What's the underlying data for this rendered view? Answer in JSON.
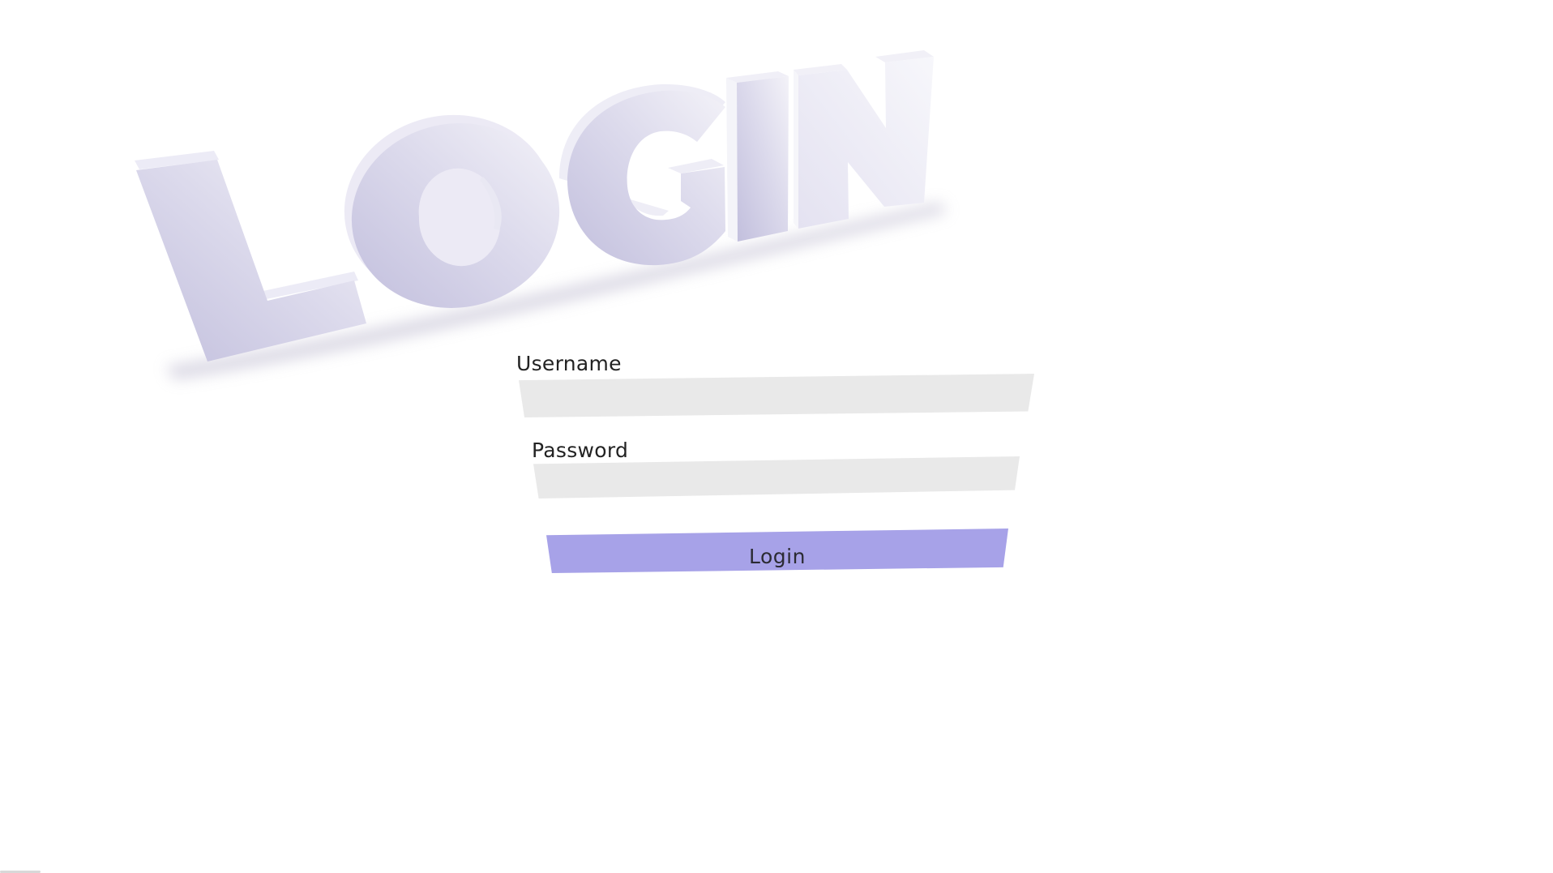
{
  "heading": {
    "text": "LOGIN",
    "letters": [
      "L",
      "O",
      "G",
      "I",
      "N"
    ]
  },
  "form": {
    "username_label": "Username",
    "username_value": "",
    "username_placeholder": "",
    "password_label": "Password",
    "password_value": "",
    "password_placeholder": "",
    "login_label": "Login"
  },
  "colors": {
    "background": "#ffffff",
    "heading_start": "#c3c0df",
    "heading_end": "#efeef6",
    "input_background": "#e9e9e9",
    "button_background": "#a7a2e8",
    "text": "#222222"
  }
}
